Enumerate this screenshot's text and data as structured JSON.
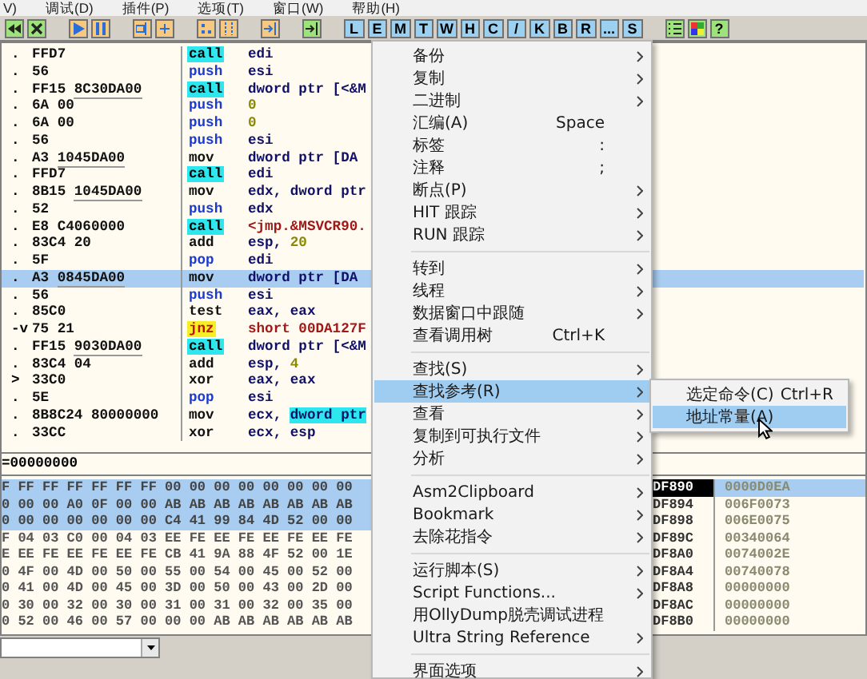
{
  "menubar": [
    "V)",
    "调试(D)",
    "插件(P)",
    "选项(T)",
    "窗口(W)",
    "帮助(H)"
  ],
  "toolbar": {
    "letter_buttons": [
      "L",
      "E",
      "M",
      "T",
      "W",
      "H",
      "C",
      "/",
      "K",
      "B",
      "R",
      "...",
      "S"
    ],
    "help_button": "?"
  },
  "code": {
    "rows": [
      {
        "marker": ".",
        "bytes": "FFD7",
        "mnemonic": "call",
        "kind": "call",
        "operand": [
          {
            "text": "edi"
          }
        ],
        "selected": false
      },
      {
        "marker": ".",
        "bytes": "56",
        "mnemonic": "push",
        "kind": "stack",
        "operand": [
          {
            "text": "esi"
          }
        ],
        "selected": false
      },
      {
        "marker": ".",
        "bytes": "FF15",
        "addr": "8C30DA00",
        "mnemonic": "call",
        "kind": "call",
        "operand": [
          {
            "text": "dword ptr [<&M"
          }
        ],
        "selected": false
      },
      {
        "marker": ".",
        "bytes": "6A 00",
        "mnemonic": "push",
        "kind": "stack",
        "operand": [
          {
            "text": "0",
            "kind": "num"
          }
        ],
        "selected": false
      },
      {
        "marker": ".",
        "bytes": "6A 00",
        "mnemonic": "push",
        "kind": "stack",
        "operand": [
          {
            "text": "0",
            "kind": "num"
          }
        ],
        "selected": false
      },
      {
        "marker": ".",
        "bytes": "56",
        "mnemonic": "push",
        "kind": "stack",
        "operand": [
          {
            "text": "esi"
          }
        ],
        "selected": false
      },
      {
        "marker": ".",
        "bytes": "A3",
        "addr": "1045DA00",
        "mnemonic": "mov",
        "kind": "plain",
        "operand": [
          {
            "text": "dword ptr [DA"
          }
        ],
        "selected": false
      },
      {
        "marker": ".",
        "bytes": "FFD7",
        "mnemonic": "call",
        "kind": "call",
        "operand": [
          {
            "text": "edi"
          }
        ],
        "selected": false
      },
      {
        "marker": ".",
        "bytes": "8B15",
        "addr": "1045DA00",
        "mnemonic": "mov",
        "kind": "plain",
        "operand": [
          {
            "text": "edx, dword ptr"
          }
        ],
        "selected": false
      },
      {
        "marker": ".",
        "bytes": "52",
        "mnemonic": "push",
        "kind": "stack",
        "operand": [
          {
            "text": "edx"
          }
        ],
        "selected": false
      },
      {
        "marker": ".",
        "bytes": "E8 C4060000",
        "mnemonic": "call",
        "kind": "call",
        "operand": [
          {
            "text": "<jmp.&MSVCR90.",
            "kind": "ref"
          }
        ],
        "selected": false
      },
      {
        "marker": ".",
        "bytes": "83C4 20",
        "mnemonic": "add",
        "kind": "plain",
        "operand": [
          {
            "text": "esp, "
          },
          {
            "text": "20",
            "kind": "num"
          }
        ],
        "selected": false
      },
      {
        "marker": ".",
        "bytes": "5F",
        "mnemonic": "pop",
        "kind": "stack",
        "operand": [
          {
            "text": "edi"
          }
        ],
        "selected": false
      },
      {
        "marker": ".",
        "bytes": "A3",
        "addr": "0845DA00",
        "mnemonic": "mov",
        "kind": "plain",
        "operand": [
          {
            "text": "dword ptr [DA"
          }
        ],
        "selected": true
      },
      {
        "marker": ".",
        "bytes": "56",
        "mnemonic": "push",
        "kind": "stack",
        "operand": [
          {
            "text": "esi"
          }
        ],
        "selected": false
      },
      {
        "marker": ".",
        "bytes": "85C0",
        "mnemonic": "test",
        "kind": "plain",
        "operand": [
          {
            "text": "eax, eax"
          }
        ],
        "selected": false
      },
      {
        "marker": "-v",
        "bytes": "75 21",
        "mnemonic": "jnz",
        "kind": "jump",
        "operand": [
          {
            "text": "short 00DA127F",
            "kind": "ref"
          }
        ],
        "selected": false
      },
      {
        "marker": ".",
        "bytes": "FF15",
        "addr": "9030DA00",
        "mnemonic": "call",
        "kind": "call",
        "operand": [
          {
            "text": "dword ptr [<&M"
          }
        ],
        "selected": false
      },
      {
        "marker": ".",
        "bytes": "83C4 04",
        "mnemonic": "add",
        "kind": "plain",
        "operand": [
          {
            "text": "esp, "
          },
          {
            "text": "4",
            "kind": "num"
          }
        ],
        "selected": false
      },
      {
        "marker": ">",
        "bytes": "33C0",
        "mnemonic": "xor",
        "kind": "plain",
        "operand": [
          {
            "text": "eax, eax"
          }
        ],
        "selected": false
      },
      {
        "marker": ".",
        "bytes": "5E",
        "mnemonic": "pop",
        "kind": "stack",
        "operand": [
          {
            "text": "esi"
          }
        ],
        "selected": false
      },
      {
        "marker": ".",
        "bytes": "8B8C24 80000000",
        "mnemonic": "mov",
        "kind": "plain",
        "operand": [
          {
            "text": "ecx, "
          },
          {
            "text": "dword ptr",
            "kind": "mark"
          }
        ],
        "selected": false
      },
      {
        "marker": ".",
        "bytes": "33CC",
        "mnemonic": "xor",
        "kind": "plain",
        "operand": [
          {
            "text": "ecx, esp"
          }
        ],
        "selected": false
      }
    ]
  },
  "info_line": "=00000000",
  "dump": {
    "rows": [
      {
        "text": "F FF FF FF FF FF FF 00 00 00 00 00 00 00 00",
        "selected": true
      },
      {
        "text": "0 00 00 A0 0F 00 00 AB AB AB AB AB AB AB AB",
        "selected": true
      },
      {
        "text": "0 00 00 00 00 00 00 C4 41 99 84 4D 52 00 00",
        "selected": true
      },
      {
        "text": "F 04 03 C0 00 04 03 EE FE EE FE EE FE EE FE",
        "selected": false
      },
      {
        "text": "E EE FE EE FE EE FE CB 41 9A 88 4F 52 00 1E",
        "selected": false
      },
      {
        "text": "0 4F 00 4D 00 50 00 55 00 54 00 45 00 52 00",
        "selected": false
      },
      {
        "text": "0 41 00 4D 00 45 00 3D 00 50 00 43 00 2D 00",
        "selected": false
      },
      {
        "text": "0 30 00 32 00 30 00 31 00 31 00 32 00 35 00",
        "selected": false
      },
      {
        "text": "0 52 00 46 00 57 00 00 00 AB AB AB AB AB AB",
        "selected": false
      }
    ]
  },
  "stack": {
    "rows": [
      {
        "address": "DF890",
        "value": "0000D0EA",
        "selected": true
      },
      {
        "address": "DF894",
        "value": "006F0073",
        "selected": false
      },
      {
        "address": "DF898",
        "value": "006E0075",
        "selected": false
      },
      {
        "address": "DF89C",
        "value": "00340064",
        "selected": false
      },
      {
        "address": "DF8A0",
        "value": "0074002E",
        "selected": false
      },
      {
        "address": "DF8A4",
        "value": "00740078",
        "selected": false
      },
      {
        "address": "DF8A8",
        "value": "00000000",
        "selected": false
      },
      {
        "address": "DF8AC",
        "value": "00000000",
        "selected": false
      },
      {
        "address": "DF8B0",
        "value": "00000000",
        "selected": false
      }
    ]
  },
  "context_menu": {
    "sections": [
      [
        {
          "label": "备份",
          "submenu": true,
          "selected": false
        },
        {
          "label": "复制",
          "submenu": true,
          "selected": false
        },
        {
          "label": "二进制",
          "submenu": true,
          "selected": false
        },
        {
          "label": "汇编(A)",
          "shortcut": "Space",
          "submenu": false,
          "selected": false
        },
        {
          "label": "标签",
          "shortcut": ":",
          "submenu": false,
          "selected": false
        },
        {
          "label": "注释",
          "shortcut": ";",
          "submenu": false,
          "selected": false
        },
        {
          "label": "断点(P)",
          "submenu": true,
          "selected": false
        },
        {
          "label": "HIT 跟踪",
          "submenu": true,
          "selected": false
        },
        {
          "label": "RUN 跟踪",
          "submenu": true,
          "selected": false
        }
      ],
      [
        {
          "label": "转到",
          "submenu": true,
          "selected": false
        },
        {
          "label": "线程",
          "submenu": true,
          "selected": false
        },
        {
          "label": "数据窗口中跟随",
          "submenu": true,
          "selected": false
        },
        {
          "label": "查看调用树",
          "shortcut": "Ctrl+K",
          "submenu": false,
          "selected": false
        }
      ],
      [
        {
          "label": "查找(S)",
          "submenu": true,
          "selected": false
        },
        {
          "label": "查找参考(R)",
          "submenu": true,
          "selected": true
        },
        {
          "label": "查看",
          "submenu": true,
          "selected": false
        },
        {
          "label": "复制到可执行文件",
          "submenu": true,
          "selected": false
        },
        {
          "label": "分析",
          "submenu": true,
          "selected": false
        }
      ],
      [
        {
          "label": "Asm2Clipboard",
          "submenu": true,
          "selected": false
        },
        {
          "label": "Bookmark",
          "submenu": true,
          "selected": false
        },
        {
          "label": "去除花指令",
          "submenu": true,
          "selected": false
        }
      ],
      [
        {
          "label": "运行脚本(S)",
          "submenu": true,
          "selected": false
        },
        {
          "label": "Script Functions...",
          "submenu": true,
          "selected": false
        },
        {
          "label": "用OllyDump脱壳调试进程",
          "submenu": false,
          "selected": false
        },
        {
          "label": "Ultra String Reference",
          "submenu": true,
          "selected": false
        }
      ],
      [
        {
          "label": "界面选项",
          "submenu": true,
          "selected": false
        }
      ]
    ]
  },
  "submenu": {
    "items": [
      {
        "label": "选定命令(C)",
        "shortcut": "Ctrl+R",
        "selected": false
      },
      {
        "label": "地址常量(A)",
        "selected": true
      }
    ]
  }
}
